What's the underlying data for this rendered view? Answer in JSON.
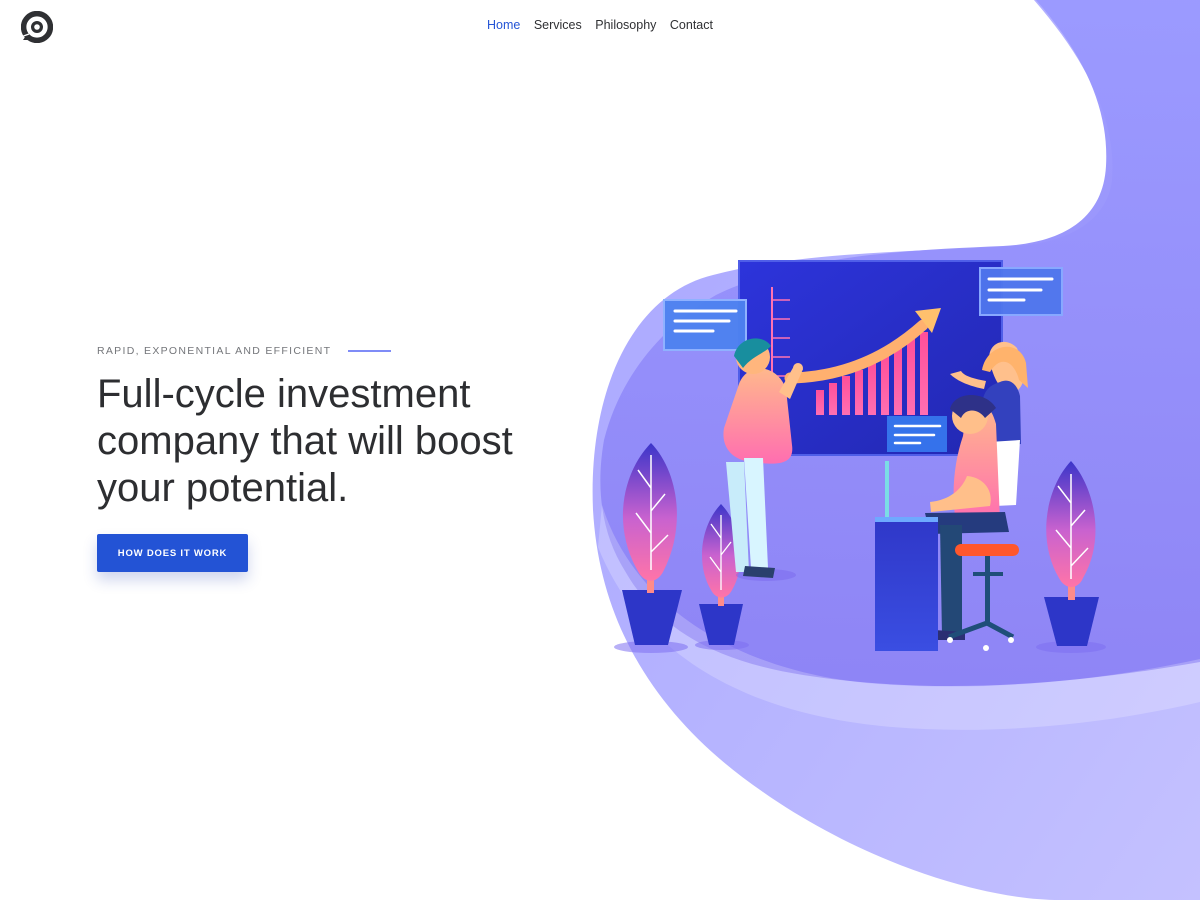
{
  "brand": {
    "logo_icon": "brand-logo-icon"
  },
  "nav": {
    "items": [
      {
        "label": "Home",
        "state": "active"
      },
      {
        "label": "Services",
        "state": "default"
      },
      {
        "label": "Philosophy",
        "state": "default"
      },
      {
        "label": "Contact",
        "state": "default"
      }
    ]
  },
  "hero": {
    "eyebrow": "RAPID, EXPONENTIAL AND EFFICIENT",
    "headline": "Full-cycle investment company that will boost your potential.",
    "cta": "HOW DOES IT WORK"
  },
  "illustration": {
    "name": "investment-team-illustration",
    "icons": [
      "chart-board-icon",
      "trend-arrow-icon",
      "message-card-icon",
      "plant-icon",
      "person-icon",
      "desk-icon",
      "chair-icon"
    ]
  },
  "colors": {
    "accent": "#2353d5",
    "text": "#2d2e31",
    "muted": "#74767a",
    "shape": "#b4b5ff",
    "shape_dark": "#9894f7",
    "board": "#2f30d8",
    "pink": "#ff5f9a"
  }
}
